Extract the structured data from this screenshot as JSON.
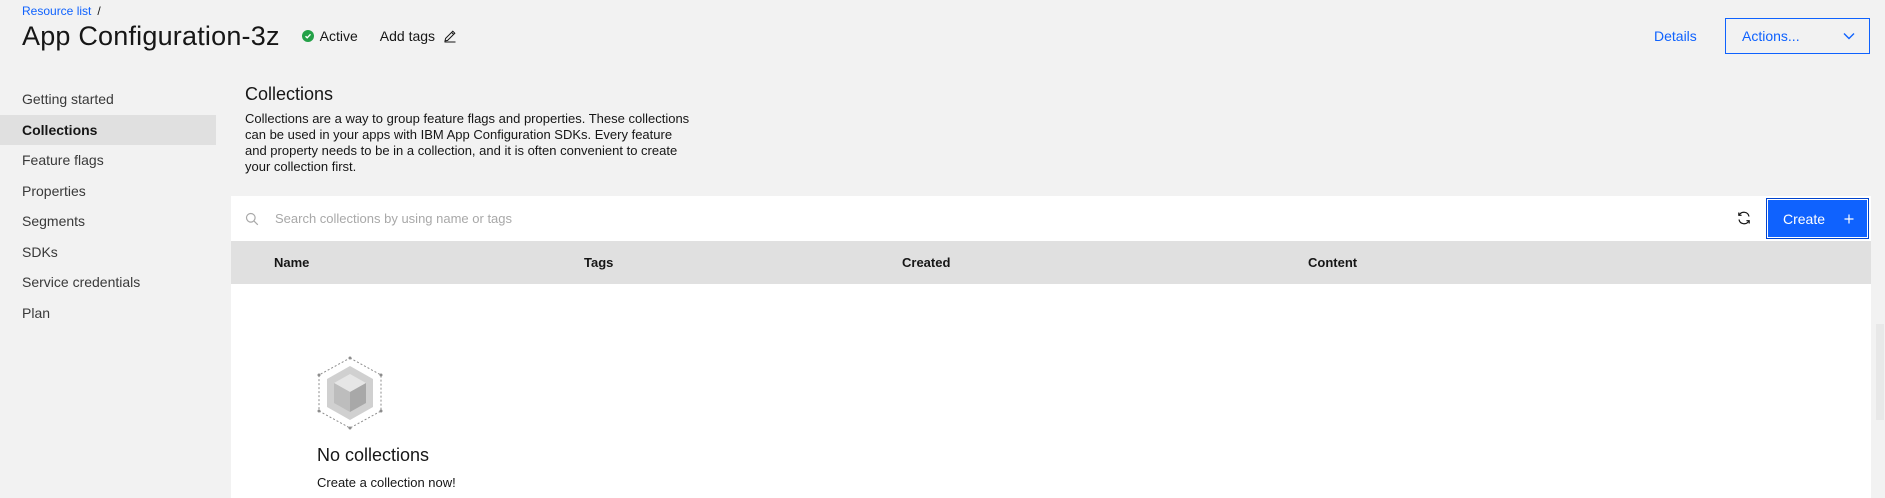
{
  "breadcrumb": {
    "link": "Resource list",
    "separator": "/"
  },
  "header": {
    "title": "App Configuration-3z",
    "status": "Active",
    "add_tags": "Add tags",
    "details": "Details",
    "actions": "Actions..."
  },
  "sidebar": {
    "items": [
      {
        "label": "Getting started"
      },
      {
        "label": "Collections",
        "active": true
      },
      {
        "label": "Feature flags"
      },
      {
        "label": "Properties"
      },
      {
        "label": "Segments"
      },
      {
        "label": "SDKs"
      },
      {
        "label": "Service credentials"
      },
      {
        "label": "Plan"
      }
    ]
  },
  "main": {
    "title": "Collections",
    "description": "Collections are a way to group feature flags and properties. These collections can be used in your apps with IBM App Configuration SDKs. Every feature and property needs to be in a collection, and it is often convenient to create your collection first.",
    "search": {
      "placeholder": "Search collections by using name or tags"
    },
    "create_label": "Create",
    "columns": [
      "Name",
      "Tags",
      "Created",
      "Content"
    ],
    "empty": {
      "title": "No collections",
      "subtitle": "Create a collection now!"
    }
  },
  "colors": {
    "accent": "#0f62fe",
    "status_active": "#24a148"
  },
  "icons": {
    "status": "check-circle-icon",
    "edit": "pencil-icon",
    "dropdown": "chevron-down-icon",
    "search": "search-icon",
    "refresh": "refresh-icon",
    "add": "plus-icon",
    "empty": "cube-icon"
  }
}
